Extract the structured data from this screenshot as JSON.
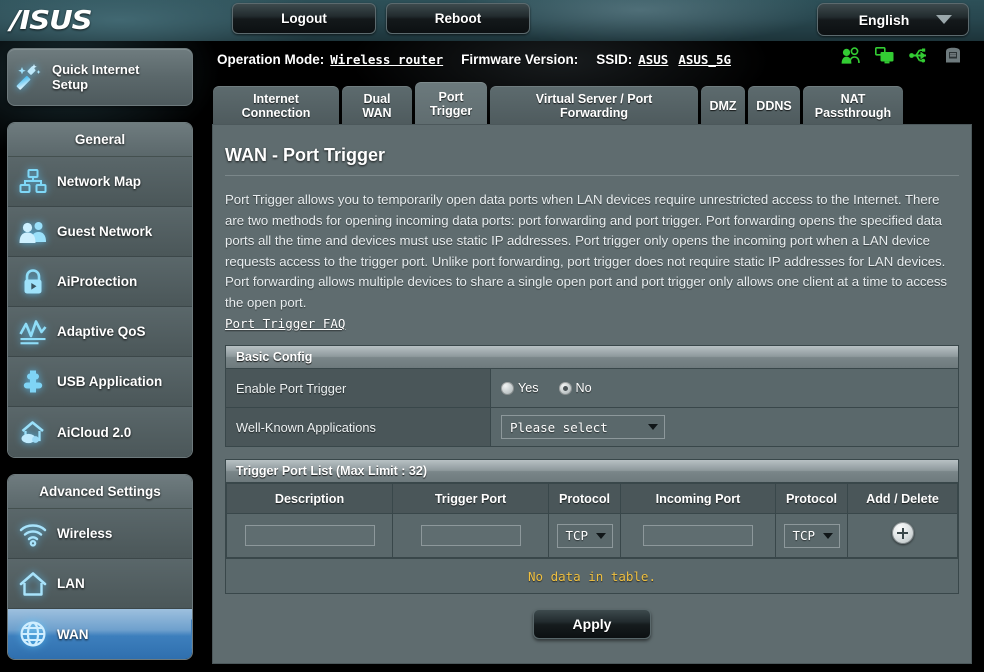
{
  "header": {
    "logo_text": "/ISUS",
    "logout_label": "Logout",
    "reboot_label": "Reboot",
    "language": "English",
    "status_icons": [
      "users-icon",
      "screen-icon",
      "usb-icon",
      "printer-icon"
    ]
  },
  "infobar": {
    "operation_mode_label": "Operation Mode:",
    "operation_mode_value": "Wireless router",
    "firmware_label": "Firmware Version:",
    "firmware_value": "",
    "ssid_label": "SSID:",
    "ssid_1": "ASUS",
    "ssid_2": "ASUS_5G"
  },
  "tabs": [
    {
      "label": "Internet Connection",
      "line1": "Internet",
      "line2": "Connection",
      "active": false
    },
    {
      "label": "Dual WAN",
      "line1": "Dual",
      "line2": "WAN",
      "active": false
    },
    {
      "label": "Port Trigger",
      "line1": "Port",
      "line2": "Trigger",
      "active": true
    },
    {
      "label": "Virtual Server / Port Forwarding",
      "line1": "Virtual Server / Port",
      "line2": "Forwarding",
      "active": false
    },
    {
      "label": "DMZ",
      "line1": "DMZ",
      "line2": "",
      "active": false
    },
    {
      "label": "DDNS",
      "line1": "DDNS",
      "line2": "",
      "active": false
    },
    {
      "label": "NAT Passthrough",
      "line1": "NAT",
      "line2": "Passthrough",
      "active": false
    }
  ],
  "page": {
    "title": "WAN - Port Trigger",
    "description": "Port Trigger allows you to temporarily open data ports when LAN devices require unrestricted access to the Internet. There are two methods for opening incoming data ports: port forwarding and port trigger. Port forwarding opens the specified data ports all the time and devices must use static IP addresses. Port trigger only opens the incoming port when a LAN device requests access to the trigger port. Unlike port forwarding, port trigger does not require static IP addresses for LAN devices. Port forwarding allows multiple devices to share a single open port and port trigger only allows one client at a time to access the open port.",
    "faq_link": "Port Trigger FAQ"
  },
  "basic_config": {
    "section_title": "Basic Config",
    "enable_label": "Enable Port Trigger",
    "enable_options": [
      "Yes",
      "No"
    ],
    "enable_selected": "No",
    "wka_label": "Well-Known Applications",
    "wka_value": "Please select"
  },
  "trigger_table": {
    "section_title": "Trigger Port List (Max Limit : 32)",
    "columns": [
      "Description",
      "Trigger Port",
      "Protocol",
      "Incoming Port",
      "Protocol",
      "Add / Delete"
    ],
    "entry_row": {
      "description_value": "",
      "trigger_port_value": "",
      "trigger_protocol": "TCP",
      "incoming_port_value": "",
      "incoming_protocol": "TCP",
      "add_icon": "plus-circle-icon"
    },
    "rows": [],
    "empty_message": "No data in table."
  },
  "apply_label": "Apply",
  "sidebar": {
    "quick_setup": {
      "label_line1": "Quick Internet",
      "label_line2": "Setup",
      "icon": "magic-wand-icon"
    },
    "groups": [
      {
        "title": "General",
        "items": [
          {
            "label": "Network Map",
            "icon": "network-map-icon",
            "active": false
          },
          {
            "label": "Guest Network",
            "icon": "guest-network-icon",
            "active": false
          },
          {
            "label": "AiProtection",
            "icon": "lock-icon",
            "active": false
          },
          {
            "label": "Adaptive QoS",
            "icon": "chart-icon",
            "active": false
          },
          {
            "label": "USB Application",
            "icon": "puzzle-icon",
            "active": false
          },
          {
            "label": "AiCloud 2.0",
            "icon": "cloud-home-icon",
            "active": false
          }
        ]
      },
      {
        "title": "Advanced Settings",
        "items": [
          {
            "label": "Wireless",
            "icon": "wifi-icon",
            "active": false
          },
          {
            "label": "LAN",
            "icon": "home-icon",
            "active": false
          },
          {
            "label": "WAN",
            "icon": "globe-icon",
            "active": true
          }
        ]
      }
    ]
  },
  "colors": {
    "accent_blue": "#3d7fbd",
    "icon_glow": "#5ac8ff",
    "panel_bg": "#5f6c6f",
    "warning_text": "#f0c040",
    "status_green": "#33cc33"
  }
}
